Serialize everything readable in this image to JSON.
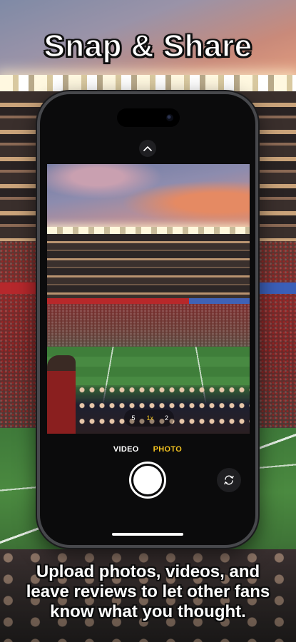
{
  "headline": "Snap & Share",
  "caption": "Upload photos, videos, and leave reviews to let other fans know what you thought.",
  "camera": {
    "modes": [
      "VIDEO",
      "PHOTO"
    ],
    "selected_mode": "PHOTO",
    "zoom_levels": [
      ".5",
      "1x",
      "2"
    ],
    "selected_zoom": "1x"
  },
  "icons": {
    "expand": "chevron-up-icon",
    "shutter": "shutter-button-icon",
    "flip": "flip-camera-icon"
  },
  "colors": {
    "accent": "#f2c220",
    "phone_body": "#0b0b0c"
  }
}
